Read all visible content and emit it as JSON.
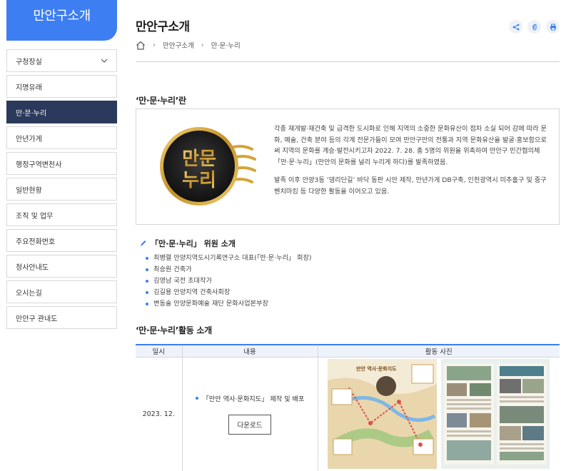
{
  "sidebar": {
    "title": "만안구소개",
    "items": [
      {
        "label": "구청장실",
        "has_chevron": true
      },
      {
        "label": "지명유래"
      },
      {
        "label": "만·문·누리",
        "active": true
      },
      {
        "label": "안년가게"
      },
      {
        "label": "행정구역변천사"
      },
      {
        "label": "일반현황"
      },
      {
        "label": "조직 및 업무"
      },
      {
        "label": "주요전화번호"
      },
      {
        "label": "청사안내도"
      },
      {
        "label": "오시는길"
      },
      {
        "label": "만안구 관내도"
      }
    ]
  },
  "header": {
    "title": "만안구소개",
    "tools": [
      "share-icon",
      "attach-icon",
      "print-icon"
    ]
  },
  "breadcrumb": {
    "home_icon": "home-icon",
    "items": [
      "만안구소개",
      "만·문·누리"
    ]
  },
  "intro": {
    "heading": "‘만·문·누리’란",
    "logo_text": "만문누리",
    "paragraph1": "각종 재개발·재건축 및 급격한 도시화로 인해 지역의 소중한 문화유산이 점차 소실 되어 감에 따라 문화, 예술, 건축 분야 등의 각계 전문가들이 모여 만안구만의 전통과 지역 문화유산을 발굴·홍보함으로써 지역의 문화를 계승·발전시키고자 2022. 7. 28. 총 5명의 위원을 위촉하여 만안구 민간협의체 「만·문·누리」(만안의 문화를 널리 누리게 하다)를 발족하였음.",
    "paragraph2": "발족 이후 안양3동 ‘댕리단길’ 바닥 동판 시안 제작, 만년가게 DB구축, 인천광역시 미추홀구 및 중구 벤치마킹 등 다양한 활동을 이어오고 있음."
  },
  "members": {
    "heading": "「만·문·누리」 위원 소개",
    "list": [
      "최병렬 안양지역도시기록연구소 대표(「만·문·누리」 회장)",
      "최승원 건축가",
      "김영남 국전 초대작가",
      "김길용 안양지역 건축사회장",
      "변동술 안양문화예술 재단 문화사업본부장"
    ]
  },
  "activities": {
    "heading": "‘만·문·누리’활동 소개",
    "columns": [
      "일시",
      "내용",
      "활동 사진"
    ],
    "rows": [
      {
        "date": "2023. 12.",
        "content": "「만안 역사·문화지도」 제작 및 배포",
        "button": "다운로드",
        "map_title": "만안 역사·문화지도"
      }
    ]
  },
  "colors": {
    "accent": "#3d7ef2",
    "sidebar_active": "#2b3a5c",
    "logo_gold": "#d6a43a"
  }
}
